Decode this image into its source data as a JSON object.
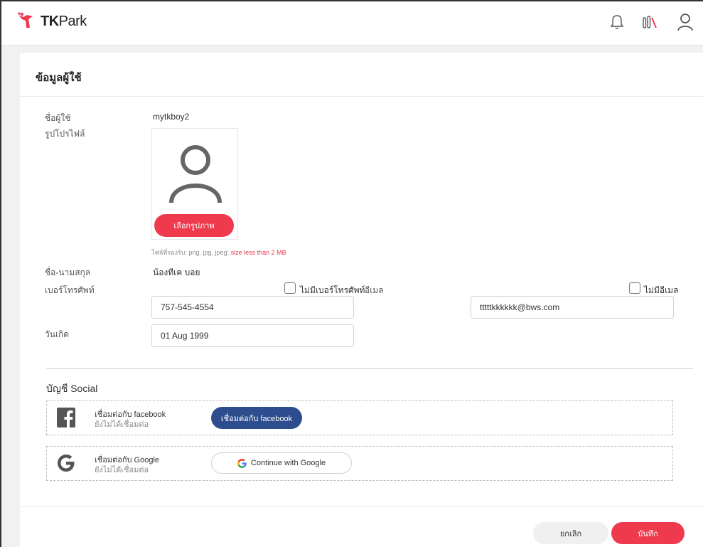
{
  "header": {
    "logo_text_tk": "TK",
    "logo_text_park": "Park",
    "icons": [
      "bell-icon",
      "library-icon",
      "user-icon"
    ]
  },
  "profile": {
    "title": "ข้อมูลผู้ใช้",
    "username_label": "ชื่อผู้ใช้",
    "username_value": "mytkboy2",
    "avatar_label": "รูปโปรไฟล์",
    "pick_image_button": "เลือกรูปภาพ",
    "file_hint": "ไฟล์ที่รองรับ: png, jpg, jpeg: ",
    "file_hint_limit": "size less than 2 MB",
    "fullname_label": "ชื่อ-นามสกุล",
    "fullname_value": "น้องทีเค บอย",
    "phone_label": "เบอร์โทรศัพท์",
    "no_phone_label": "ไม่มีเบอร์โทรศัพท์",
    "phone_value": "757-545-4554",
    "email_label": "อีเมล",
    "no_email_label": "ไม่มีอีเมล",
    "email_value": "tttttkkkkkk@bws.com",
    "birthday_label": "วันเกิด",
    "birthday_value": "01 Aug 1999"
  },
  "social": {
    "title": "บัญชี Social",
    "facebook": {
      "name": "เชื่อมต่อกับ facebook",
      "status": "ยังไม่ได้เชื่อมต่อ",
      "button": "เชื่อมต่อกับ facebook"
    },
    "google": {
      "name": "เชื่อมต่อกับ Google",
      "status": "ยังไม่ได้เชื่อมต่อ",
      "button": "Continue with Google"
    }
  },
  "footer": {
    "cancel": "ยกเลิก",
    "save": "บันทึก"
  },
  "colors": {
    "accent": "#ef3a4e",
    "facebook": "#2d4d8e"
  }
}
